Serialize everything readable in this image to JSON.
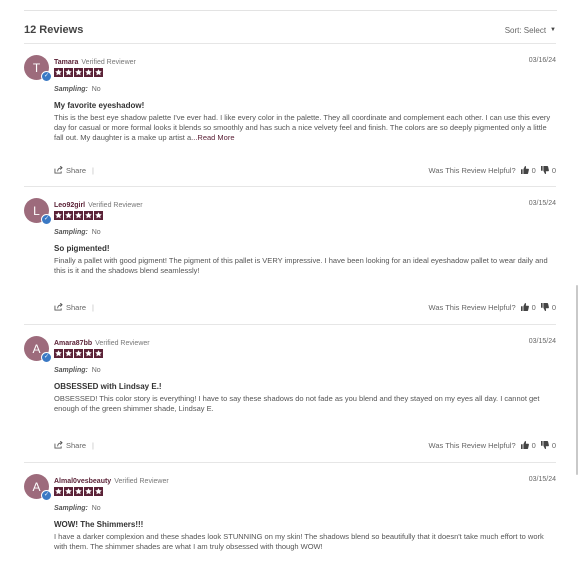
{
  "header": {
    "review_count": "12 Reviews",
    "sort_label": "Sort: Select"
  },
  "labels": {
    "sampling_label": "Sampling:",
    "share_label": "Share",
    "helpful_label": "Was This Review Helpful?",
    "read_more": "...Read More"
  },
  "colors": {
    "avatar_bg": "#9d6b7c",
    "star_color": "#5b2237",
    "verified_badge": "#3a79c4"
  },
  "reviews": [
    {
      "initial": "T",
      "name": "Tamara",
      "verified": "Verified Reviewer",
      "date": "03/16/24",
      "rating": 5,
      "sampling": "No",
      "title": "My favorite eyeshadow!",
      "text": "This is the best eye shadow palette I've ever had. I like every color in the palette. They all coordinate and complement each other. I can use this every day for casual or more formal looks it blends so smoothly and has such a nice velvety feel and finish. The colors are so deeply pigmented only a little fall out. My daughter is a make up artist a",
      "helpful_up": "0",
      "helpful_down": "0"
    },
    {
      "initial": "L",
      "name": "Leo92girl",
      "verified": "Verified Reviewer",
      "date": "03/15/24",
      "rating": 5,
      "sampling": "No",
      "title": "So pigmented!",
      "text": "Finally a pallet with good pigment! The pigment of this pallet is VERY impressive. I have been looking for an ideal eyeshadow pallet to wear daily and this is it and the shadows blend seamlessly!",
      "helpful_up": "0",
      "helpful_down": "0"
    },
    {
      "initial": "A",
      "name": "Amara87bb",
      "verified": "Verified Reviewer",
      "date": "03/15/24",
      "rating": 5,
      "sampling": "No",
      "title": "OBSESSED with Lindsay E.!",
      "text": "OBSESSED! This color story is everything! I have to say these shadows do not fade as you blend and they stayed on my eyes all day. I cannot get enough of the green shimmer shade, Lindsay E.",
      "helpful_up": "0",
      "helpful_down": "0"
    },
    {
      "initial": "A",
      "name": "Almal0vesbeauty",
      "verified": "Verified Reviewer",
      "date": "03/15/24",
      "rating": 5,
      "sampling": "No",
      "title": "WOW! The Shimmers!!!",
      "text": "I have a darker complexion and these shades look STUNNING on my skin! The shadows blend so beautifully that it doesn't take much effort to work with them. The shimmer shades are what I am truly obsessed with though WOW!",
      "helpful_up": "0",
      "helpful_down": "0"
    }
  ]
}
